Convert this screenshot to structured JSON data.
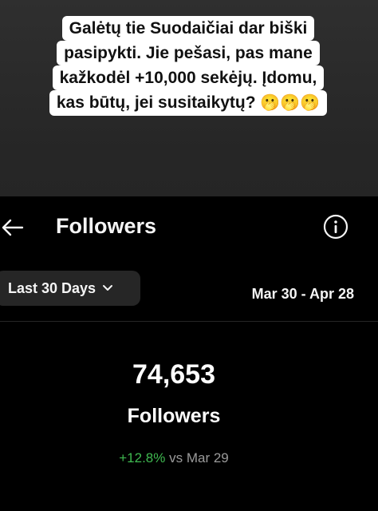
{
  "caption": {
    "lines": [
      "Galėtų tie Suodaičiai dar biški",
      "pasipykti. Jie pešasi, pas mane",
      "kažkodėl +10,000 sekėjų. Įdomu,",
      "kas būtų, jei susitaikytų?"
    ],
    "emoji": "🫢🫢🫢"
  },
  "header": {
    "title": "Followers",
    "back_icon": "arrow-left-icon",
    "info_icon": "info-icon"
  },
  "filter": {
    "range_label": "Last 30 Days",
    "date_range": "Mar 30 - Apr 28"
  },
  "stats": {
    "followers_count": "74,653",
    "followers_label": "Followers",
    "change_pct": "+12.8%",
    "change_compare": "vs Mar 29",
    "positive_color": "#3fb950"
  }
}
